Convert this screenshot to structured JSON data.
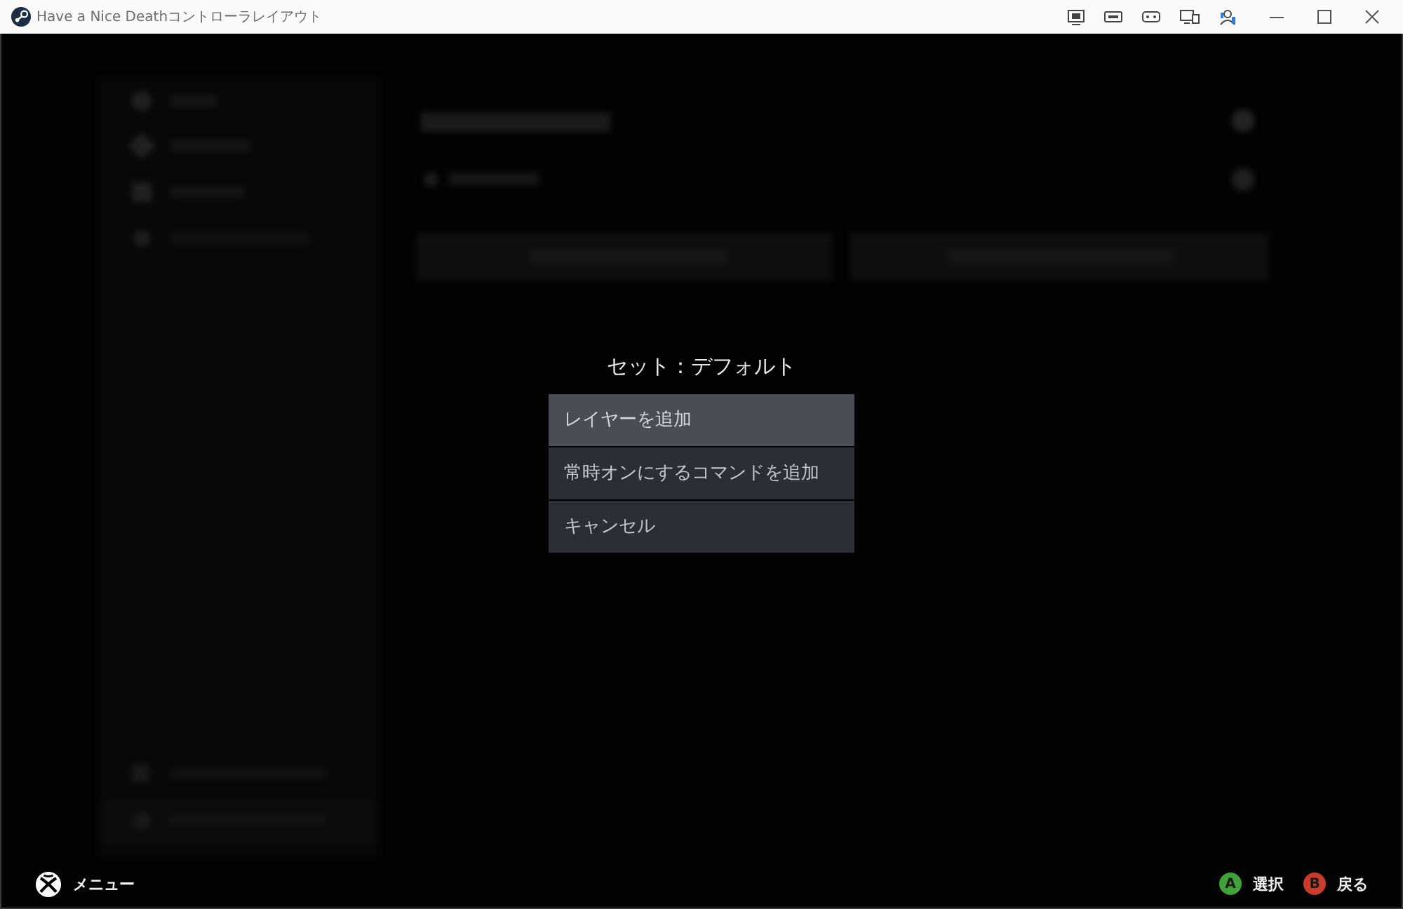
{
  "window": {
    "title": "Have a Nice Deathコントローラレイアウト"
  },
  "dialog": {
    "title": "セット：デフォルト",
    "items": [
      {
        "label": "レイヤーを追加",
        "selected": true
      },
      {
        "label": "常時オンにするコマンドを追加",
        "selected": false
      },
      {
        "label": "キャンセル",
        "selected": false
      }
    ]
  },
  "footer": {
    "menu": {
      "label": "メニュー"
    },
    "hints": [
      {
        "glyph": "A",
        "label": "選択",
        "color": "#43a13b"
      },
      {
        "glyph": "B",
        "label": "戻る",
        "color": "#c93b2c"
      }
    ]
  }
}
